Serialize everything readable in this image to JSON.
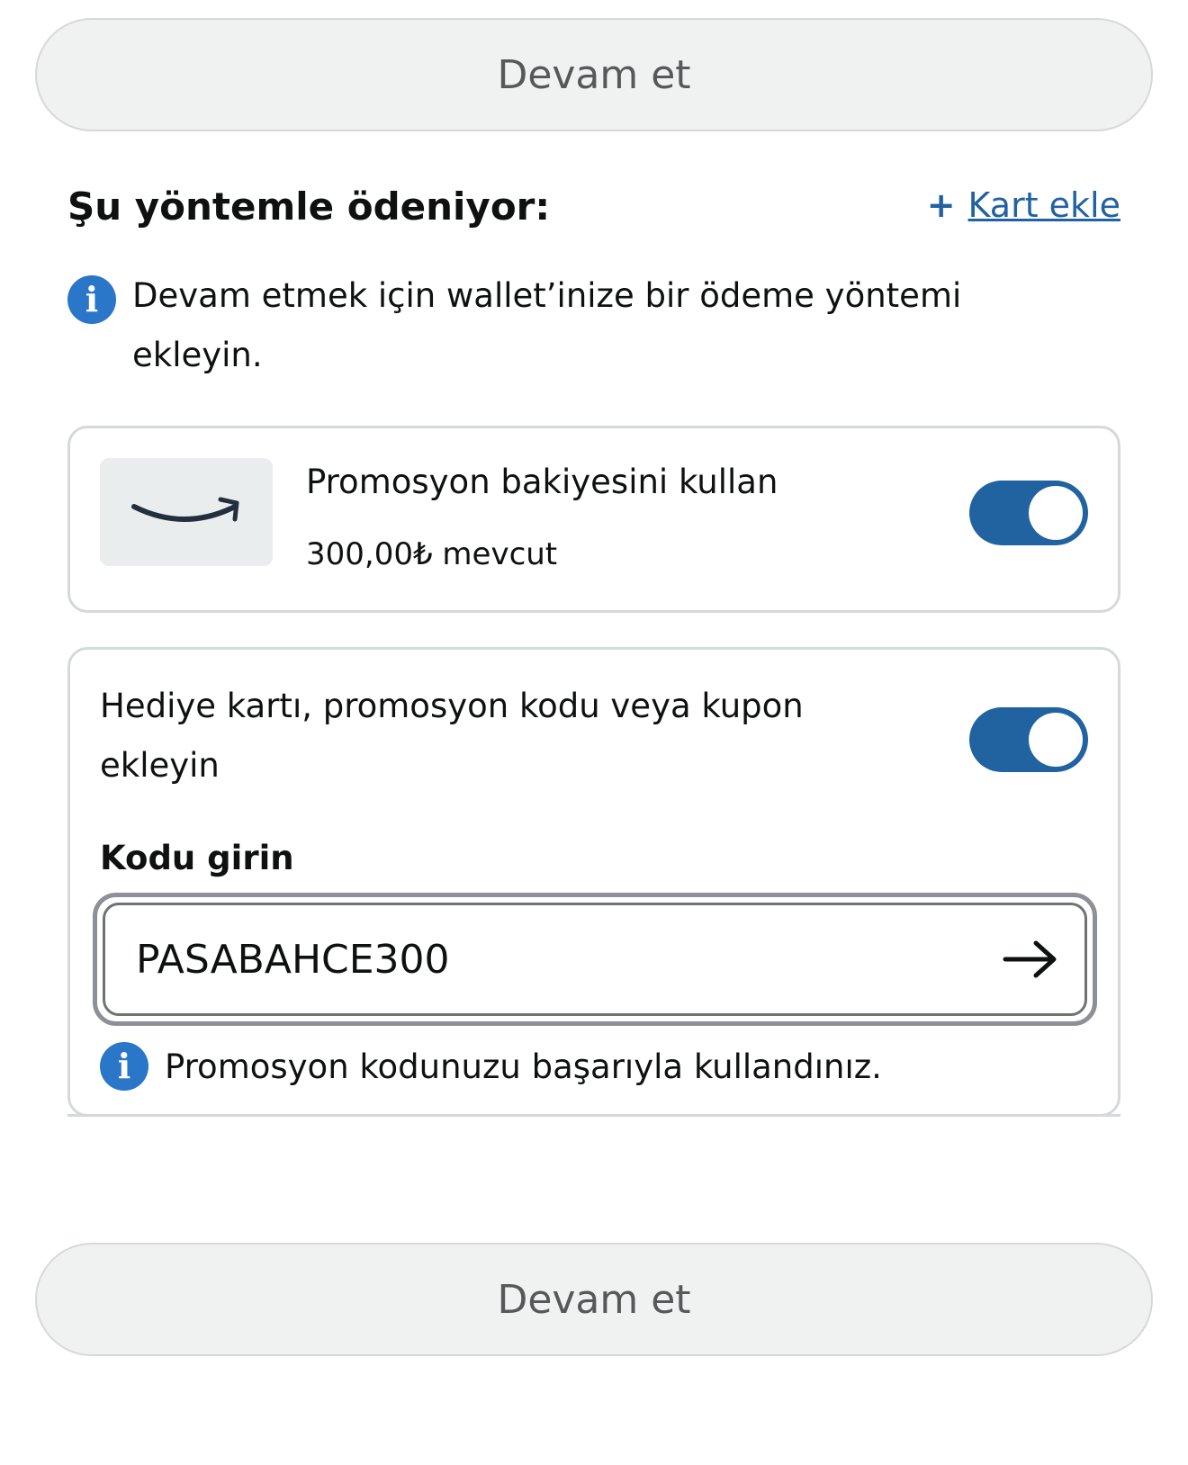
{
  "buttons": {
    "continue_top": "Devam et",
    "continue_bottom": "Devam et"
  },
  "payment": {
    "title": "Şu yöntemle ödeniyor:",
    "add_card": {
      "icon": "plus-icon",
      "label": "Kart ekle"
    },
    "notice": {
      "icon": "info-icon",
      "text": "Devam etmek için wallet’inize bir ödeme yöntemi ekleyin."
    }
  },
  "promo_balance": {
    "logo": "amazon-smile-logo",
    "title": "Promosyon bakiyesini kullan",
    "available": "300,00₺ mevcut",
    "toggle_on": true
  },
  "gift_code": {
    "title": "Hediye kartı, promosyon kodu veya kupon ekleyin",
    "toggle_on": true,
    "input_label": "Kodu girin",
    "input_value": "PASABAHCE300",
    "submit_icon": "arrow-right-icon",
    "success_icon": "info-icon",
    "success_message": "Promosyon kodunuzu başarıyla kullandınız."
  },
  "colors": {
    "accent": "#2162a1",
    "info": "#2a76c9",
    "button_bg": "#f0f2f2",
    "border": "#d5d9d9"
  }
}
